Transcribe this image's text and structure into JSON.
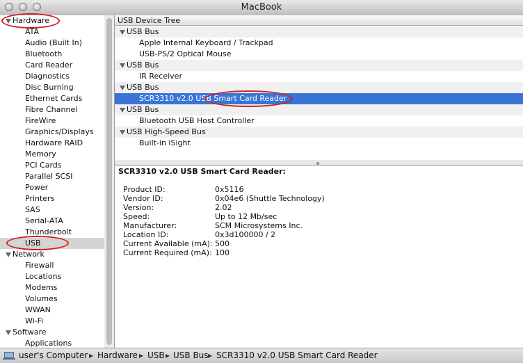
{
  "window": {
    "title": "MacBook"
  },
  "sidebar": {
    "categories": [
      {
        "label": "Hardware",
        "items": [
          "ATA",
          "Audio (Built In)",
          "Bluetooth",
          "Card Reader",
          "Diagnostics",
          "Disc Burning",
          "Ethernet Cards",
          "Fibre Channel",
          "FireWire",
          "Graphics/Displays",
          "Hardware RAID",
          "Memory",
          "PCI Cards",
          "Parallel SCSI",
          "Power",
          "Printers",
          "SAS",
          "Serial-ATA",
          "Thunderbolt",
          "USB"
        ]
      },
      {
        "label": "Network",
        "items": [
          "Firewall",
          "Locations",
          "Modems",
          "Volumes",
          "WWAN",
          "Wi-Fi"
        ]
      },
      {
        "label": "Software",
        "items": [
          "Applications"
        ]
      }
    ],
    "selected": "USB"
  },
  "tree": {
    "header": "USB Device Tree",
    "rows": [
      {
        "type": "bus",
        "label": "USB Bus"
      },
      {
        "type": "device",
        "label": "Apple Internal Keyboard / Trackpad"
      },
      {
        "type": "device",
        "label": "USB-PS/2 Optical Mouse"
      },
      {
        "type": "bus",
        "label": "USB Bus"
      },
      {
        "type": "device",
        "label": "IR Receiver"
      },
      {
        "type": "bus",
        "label": "USB Bus"
      },
      {
        "type": "device",
        "label": "SCR3310 v2.0 USB Smart Card Reader",
        "selected": true
      },
      {
        "type": "bus",
        "label": "USB Bus"
      },
      {
        "type": "device",
        "label": "Bluetooth USB Host Controller"
      },
      {
        "type": "bus",
        "label": "USB High-Speed Bus"
      },
      {
        "type": "device",
        "label": "Built-in iSight"
      }
    ]
  },
  "details": {
    "title": "SCR3310 v2.0 USB Smart Card Reader:",
    "fields": [
      {
        "key": "Product ID:",
        "value": "0x5116"
      },
      {
        "key": "Vendor ID:",
        "value": "0x04e6  (Shuttle Technology)"
      },
      {
        "key": "Version:",
        "value": "2.02"
      },
      {
        "key": "Speed:",
        "value": "Up to 12 Mb/sec"
      },
      {
        "key": "Manufacturer:",
        "value": "SCM Microsystems Inc."
      },
      {
        "key": "Location ID:",
        "value": "0x3d100000 / 2"
      },
      {
        "key": "Current Available (mA):",
        "value": "500"
      },
      {
        "key": "Current Required (mA):",
        "value": "100"
      }
    ]
  },
  "pathbar": {
    "icon": "computer-icon",
    "crumbs": [
      "user's Computer",
      "Hardware",
      "USB",
      "USB Bus",
      "SCR3310 v2.0 USB Smart Card Reader"
    ]
  },
  "colors": {
    "selection": "#3875d7",
    "annotation": "#d41d1d"
  }
}
